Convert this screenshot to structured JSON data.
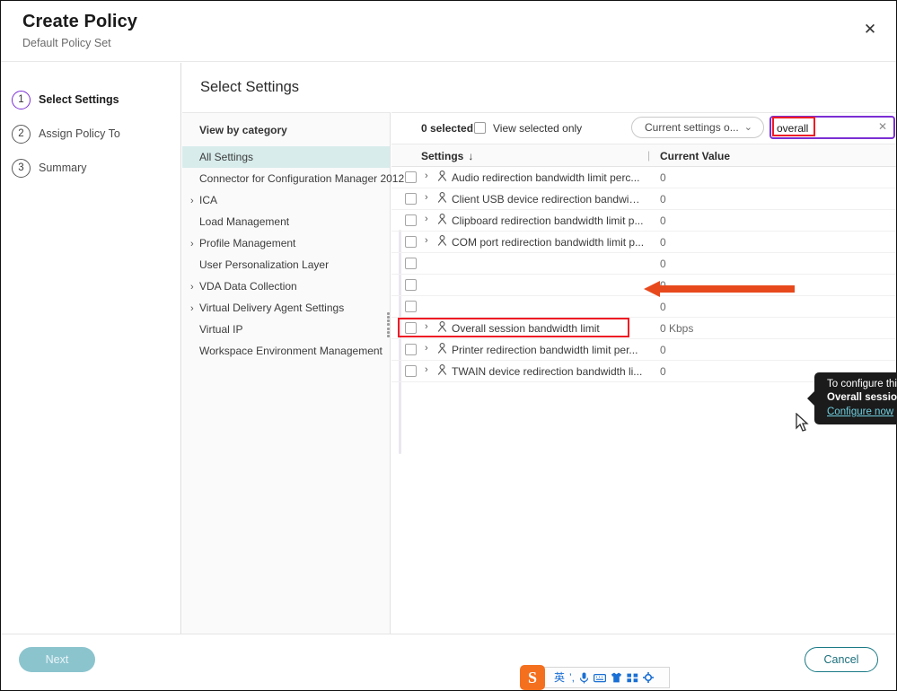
{
  "header": {
    "title": "Create Policy",
    "subtitle": "Default Policy Set",
    "close_label": "✕"
  },
  "steps": [
    {
      "num": "1",
      "label": "Select Settings",
      "active": true
    },
    {
      "num": "2",
      "label": "Assign Policy To",
      "active": false
    },
    {
      "num": "3",
      "label": "Summary",
      "active": false
    }
  ],
  "main": {
    "title": "Select Settings"
  },
  "categories": {
    "header": "View by category",
    "items": [
      {
        "label": "All Settings",
        "chevron": false,
        "selected": true
      },
      {
        "label": "Connector for Configuration Manager 2012",
        "chevron": false,
        "selected": false
      },
      {
        "label": "ICA",
        "chevron": true,
        "selected": false
      },
      {
        "label": "Load Management",
        "chevron": false,
        "selected": false
      },
      {
        "label": "Profile Management",
        "chevron": true,
        "selected": false
      },
      {
        "label": "User Personalization Layer",
        "chevron": false,
        "selected": false
      },
      {
        "label": "VDA Data Collection",
        "chevron": true,
        "selected": false
      },
      {
        "label": "Virtual Delivery Agent Settings",
        "chevron": true,
        "selected": false
      },
      {
        "label": "Virtual IP",
        "chevron": false,
        "selected": false
      },
      {
        "label": "Workspace Environment Management",
        "chevron": false,
        "selected": false
      }
    ]
  },
  "toolbar": {
    "selected_count": "0 selected",
    "view_selected_only": "View selected only",
    "filter_value": "Current settings o...",
    "filter_chevron": "⌄",
    "search_value": "overall",
    "search_placeholder": "Search",
    "search_clear": "✕"
  },
  "table": {
    "col_settings": "Settings",
    "sort_arrow": "↓",
    "col_divider": "|",
    "col_value": "Current Value",
    "rows": [
      {
        "label": "Audio redirection bandwidth limit perc...",
        "value": "0",
        "chevron": "›",
        "user_icon": "user-icon",
        "highlight": false
      },
      {
        "label": "Client USB device redirection bandwidt...",
        "value": "0",
        "chevron": "›",
        "user_icon": "user-icon",
        "highlight": false
      },
      {
        "label": "Clipboard redirection bandwidth limit p...",
        "value": "0",
        "chevron": "›",
        "user_icon": "user-icon",
        "highlight": false
      },
      {
        "label": "COM port redirection bandwidth limit p...",
        "value": "0",
        "chevron": "›",
        "user_icon": "user-icon",
        "highlight": false
      },
      {
        "label": "",
        "value": "0",
        "chevron": "",
        "user_icon": "",
        "highlight": false
      },
      {
        "label": "",
        "value": "0",
        "chevron": "",
        "user_icon": "",
        "highlight": false
      },
      {
        "label": "",
        "value": "0",
        "chevron": "",
        "user_icon": "",
        "highlight": false
      },
      {
        "label": "Overall session bandwidth limit",
        "value": "0 Kbps",
        "chevron": "›",
        "user_icon": "user-icon",
        "highlight": true
      },
      {
        "label": "Printer redirection bandwidth limit per...",
        "value": "0",
        "chevron": "›",
        "user_icon": "user-icon",
        "highlight": false
      },
      {
        "label": "TWAIN device redirection bandwidth li...",
        "value": "0",
        "chevron": "›",
        "user_icon": "user-icon",
        "highlight": false
      }
    ]
  },
  "tooltip": {
    "line1": "To configure this setting, first configure the",
    "line2": "Overall session bandwidth limit",
    "link": "Configure now"
  },
  "footer": {
    "next_label": "Next",
    "cancel_label": "Cancel"
  },
  "ime": {
    "logo": "S",
    "icons": [
      "英",
      "’,",
      "mic-icon",
      "keyboard-icon",
      "shirt-icon",
      "grid-icon",
      "gear-icon"
    ]
  },
  "colors": {
    "accent_purple": "#7b2fd4",
    "highlight_red": "#ee1c25",
    "annotation_orange": "#e8491c",
    "selected_teal": "#d8ecec",
    "button_teal": "#1b7a86",
    "tooltip_bg": "#1b1b1b",
    "tooltip_link": "#6fcfe0"
  }
}
